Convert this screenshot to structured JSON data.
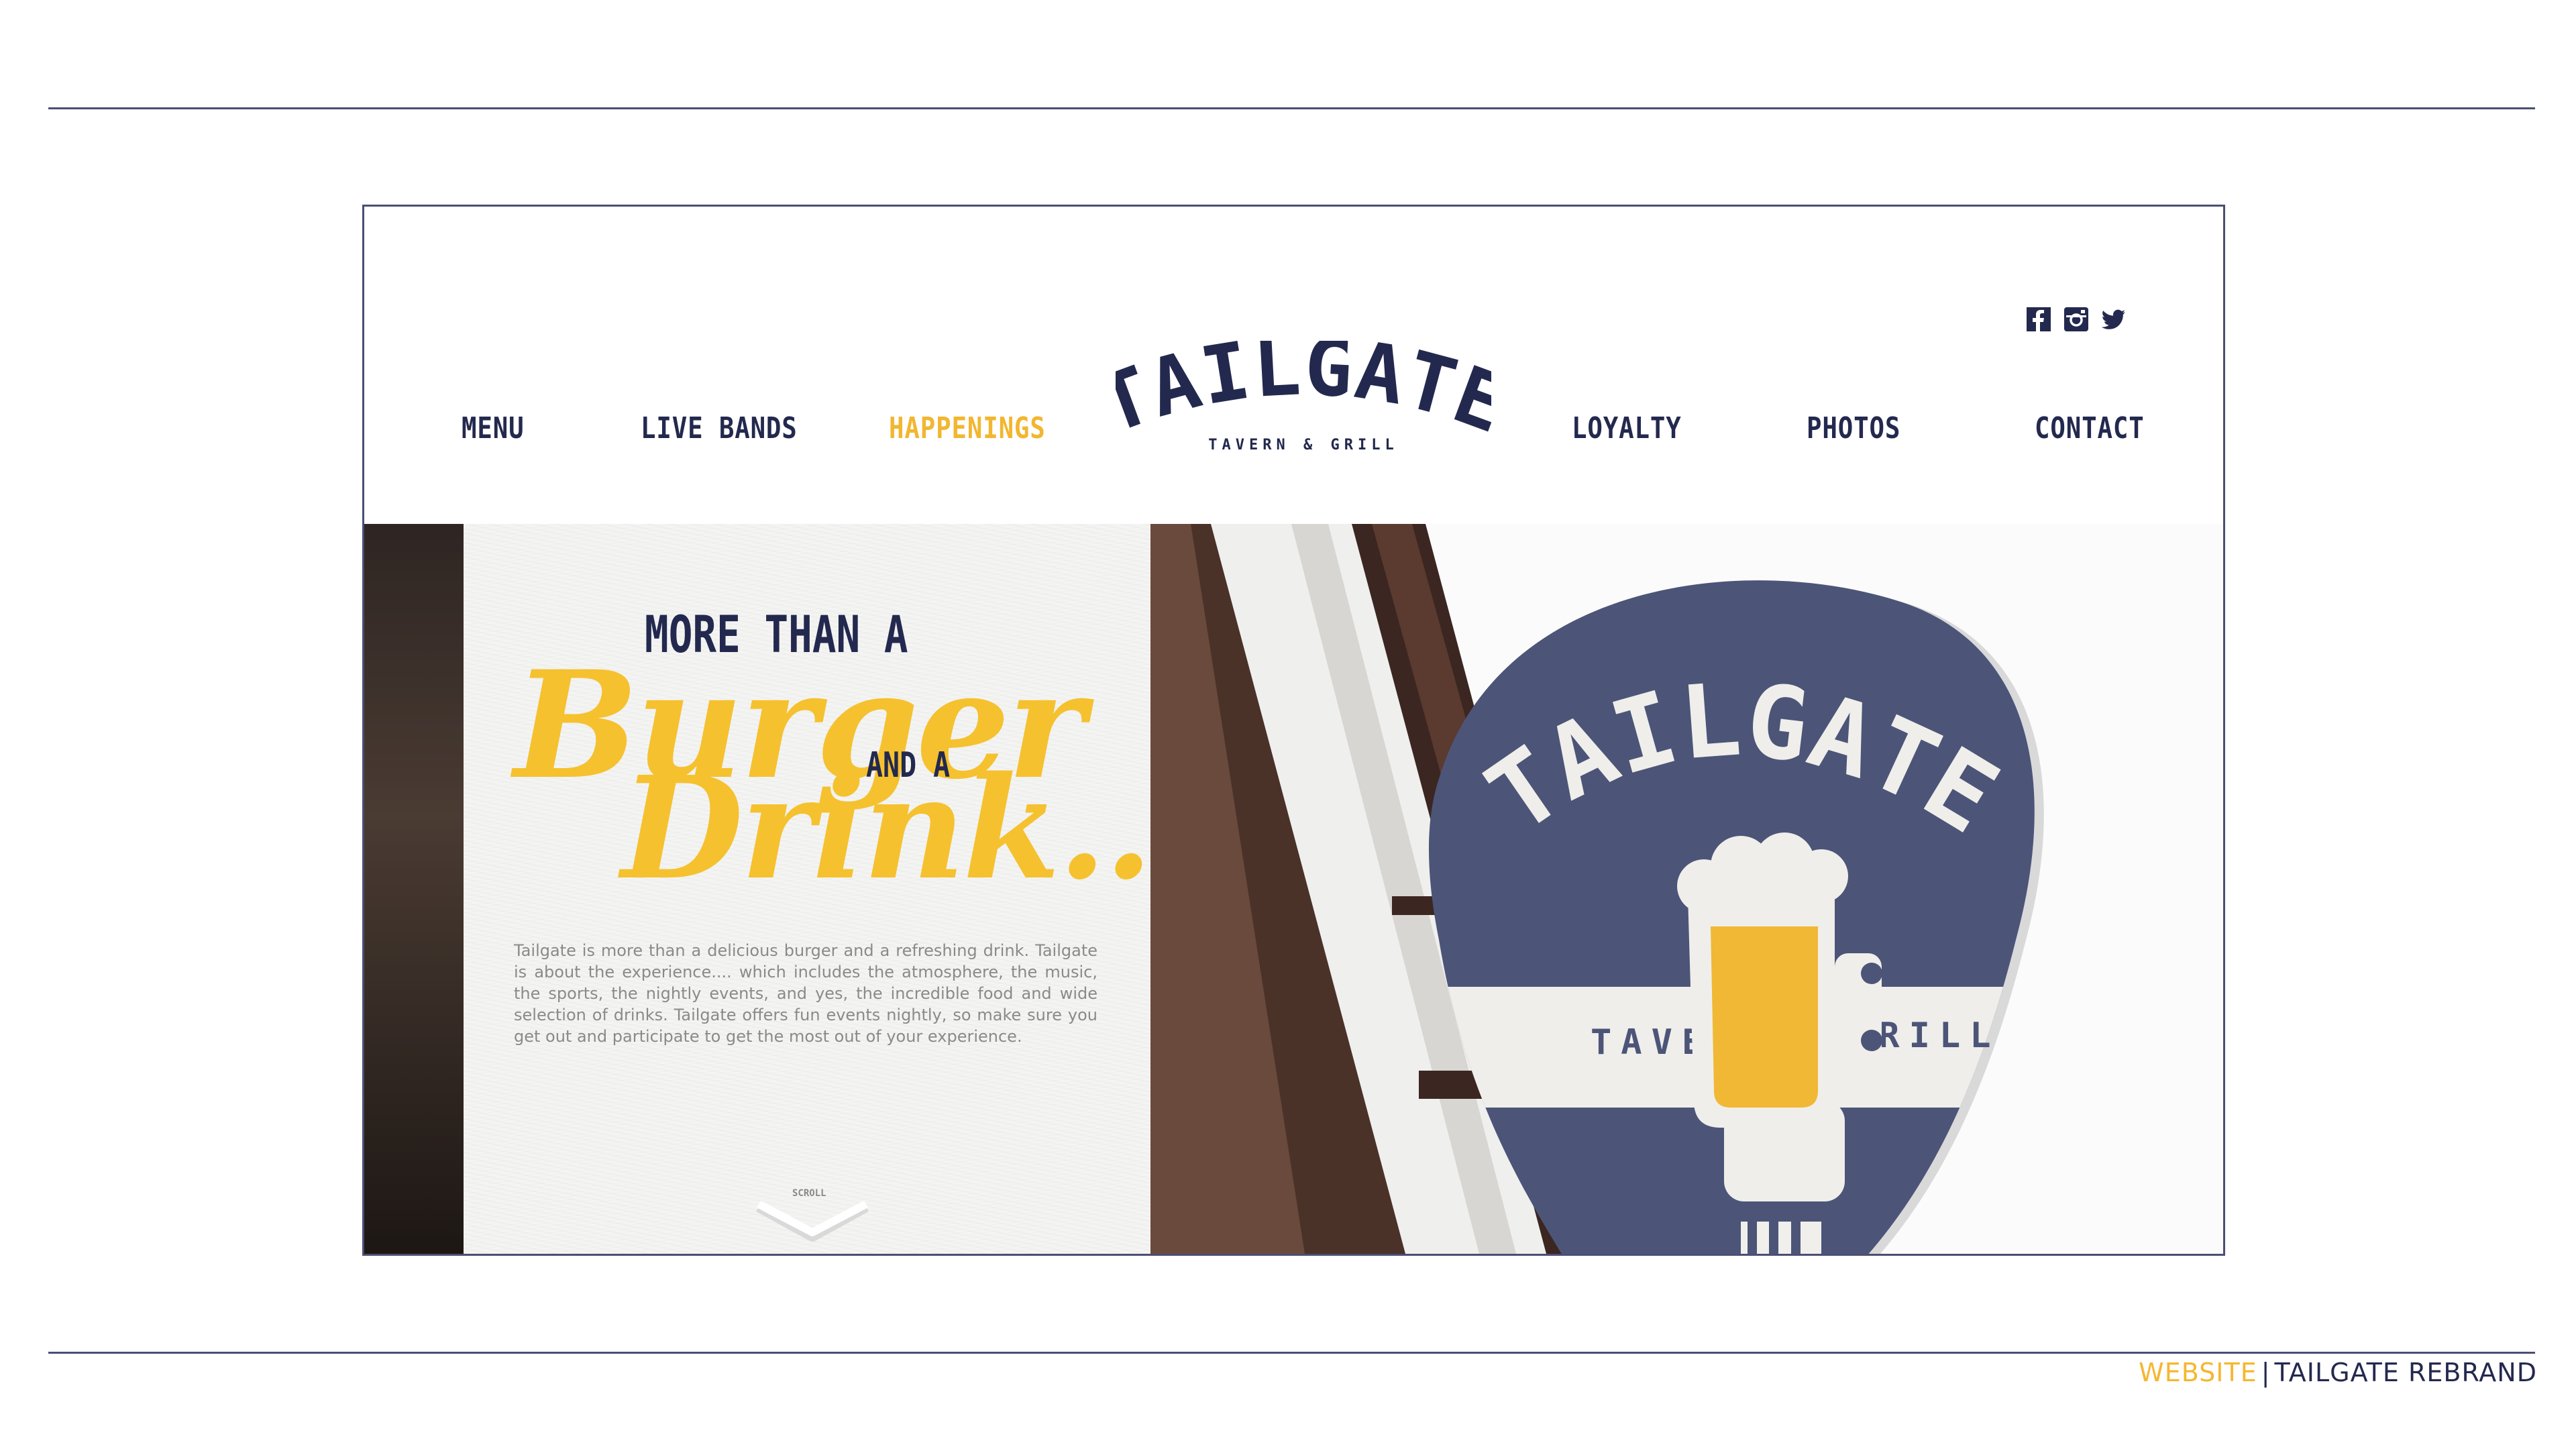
{
  "nav": {
    "items": [
      {
        "label": "MENU"
      },
      {
        "label": "LIVE BANDS"
      },
      {
        "label": "HAPPENINGS"
      },
      {
        "label": "LOYALTY"
      },
      {
        "label": "PHOTOS"
      },
      {
        "label": "CONTACT"
      }
    ],
    "active_color": "#f2b630",
    "color": "#23294e"
  },
  "logo": {
    "wordmark": "TAILGATE",
    "tagline": "TAVERN & GRILL"
  },
  "social": [
    {
      "icon": "facebook-icon"
    },
    {
      "icon": "instagram-icon"
    },
    {
      "icon": "twitter-icon"
    }
  ],
  "hero": {
    "headline_top": "MORE THAN A",
    "headline_script_1": "Burger",
    "headline_mid": "AND A",
    "headline_script_2": "Drink...",
    "body": "Tailgate is more than a delicious burger and a refreshing drink. Tailgate is about the experience.... which includes the atmosphere, the music, the sports, the nightly events, and yes, the incredible food and wide selection of drinks. Tailgate offers fun events nightly, so make sure you get out and participate to get the most out of your experience.",
    "scroll_label": "SCROLL"
  },
  "sign": {
    "wordmark": "TAILGATE",
    "left": "TAVERN",
    "right": "GRILL"
  },
  "footer": {
    "caption_a": "WEBSITE",
    "separator": "|",
    "caption_b": "TAILGATE REBRAND"
  },
  "colors": {
    "navy": "#23294e",
    "gold": "#f5c12e",
    "sign_blue": "#4c5578"
  }
}
